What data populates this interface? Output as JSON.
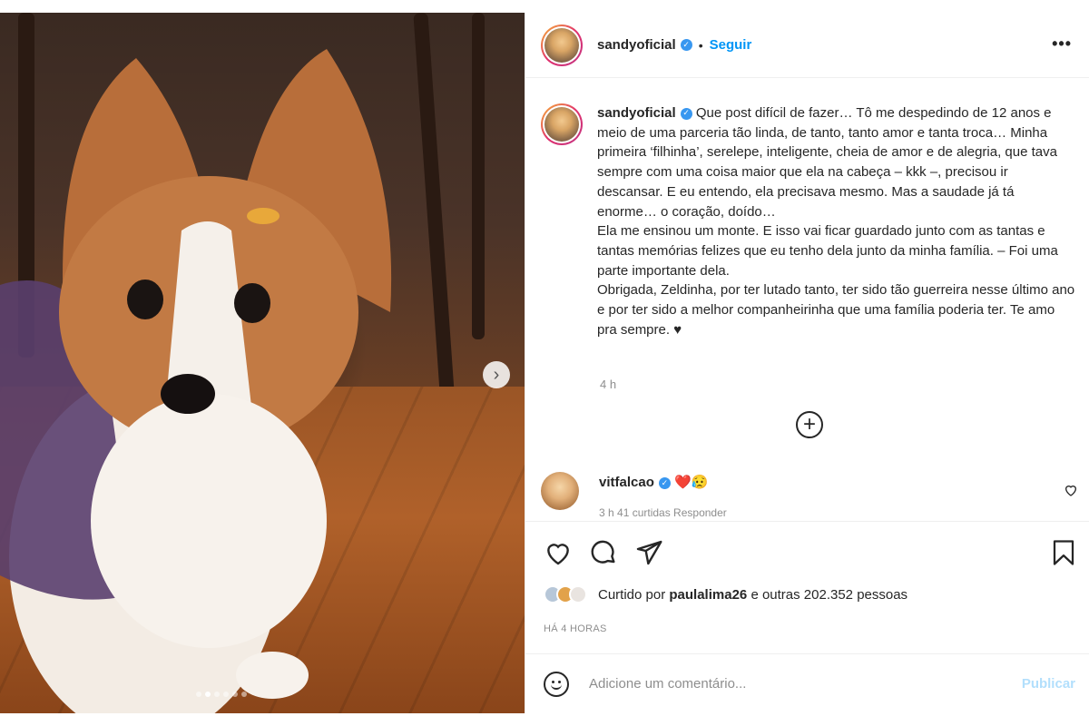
{
  "post": {
    "username": "sandyoficial",
    "follow_label": "Seguir",
    "separator": "•",
    "more_label": "•••",
    "caption": "Que post difícil de fazer… Tô me despedindo de 12 anos e meio de uma parceria tão linda, de tanto, tanto amor e tanta troca… Minha primeira ‘filhinha’, serelepe, inteligente, cheia de amor e de alegria, que tava sempre com uma coisa maior que ela na cabeça – kkk –, precisou ir descansar. E eu entendo, ela precisava mesmo. Mas a saudade já tá enorme… o coração, doído…",
    "caption_p2": "Ela me ensinou um monte. E isso vai ficar guardado junto com as tantas e tantas memórias felizes que eu tenho dela junto da minha família. – Foi uma parte importante dela.",
    "caption_p3": "Obrigada, Zeldinha, por ter lutado tanto, ter sido tão guerreira nesse último ano e por ter sido a melhor companheirinha que uma família poderia ter. Te amo pra sempre. ♥",
    "caption_time": "4 h",
    "load_more": "+"
  },
  "media": {
    "next_label": "›",
    "slide_count": 6,
    "active_slide": 2
  },
  "comment": {
    "username": "vitfalcao",
    "text": "❤️😥",
    "meta": "3 h   41 curtidas   Responder"
  },
  "actions": {
    "liked_by_prefix": "Curtido por",
    "liked_by_user": "paulalima26",
    "liked_by_suffix": "e outras 202.352 pessoas",
    "timestamp": "HÁ 4 HORAS"
  },
  "add_comment": {
    "placeholder": "Adicione um comentário...",
    "publish_label": "Publicar"
  },
  "colors": {
    "accent": "#0095f6",
    "publish_disabled": "#b2dffc",
    "muted": "#8e8e8e",
    "verified": "#3897f0"
  },
  "icons": [
    "verified-badge-icon",
    "more-options-icon",
    "chevron-right-icon",
    "plus-circle-icon",
    "heart-icon",
    "comment-icon",
    "share-icon",
    "bookmark-icon",
    "emoji-icon"
  ]
}
